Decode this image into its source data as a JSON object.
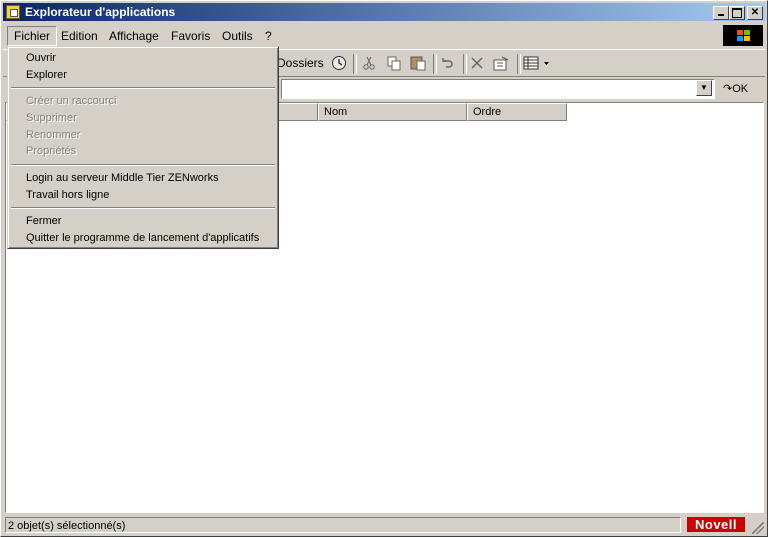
{
  "window": {
    "title": "Explorateur d'applications"
  },
  "menubar": {
    "items": [
      {
        "label": "Fichier"
      },
      {
        "label": "Edition"
      },
      {
        "label": "Affichage"
      },
      {
        "label": "Favoris"
      },
      {
        "label": "Outils"
      },
      {
        "label": "?"
      }
    ]
  },
  "toolbar": {
    "folders_label": "Dossiers"
  },
  "addressbar": {
    "value": "",
    "ok_label": "OK"
  },
  "list": {
    "columns": [
      {
        "label": "Nom"
      },
      {
        "label": "Ordre"
      }
    ]
  },
  "file_menu": {
    "items": [
      {
        "label": "Ouvrir",
        "enabled": true
      },
      {
        "label": "Explorer",
        "enabled": true
      },
      {
        "label": "Créer un raccourci",
        "enabled": false
      },
      {
        "label": "Supprimer",
        "enabled": false
      },
      {
        "label": "Renommer",
        "enabled": false
      },
      {
        "label": "Propriétés",
        "enabled": false
      },
      {
        "label": "Login au serveur Middle Tier ZENworks",
        "enabled": true
      },
      {
        "label": "Travail hors ligne",
        "enabled": true
      },
      {
        "label": "Fermer",
        "enabled": true
      },
      {
        "label": "Quitter le programme de lancement d'applicatifs",
        "enabled": true
      }
    ]
  },
  "statusbar": {
    "text": "2 objet(s) sélectionné(s)",
    "brand": "Novell"
  },
  "colors": {
    "title_start": "#0a246a",
    "title_end": "#a6caf0",
    "face": "#d4d0c8",
    "brand_red": "#cc0000"
  }
}
